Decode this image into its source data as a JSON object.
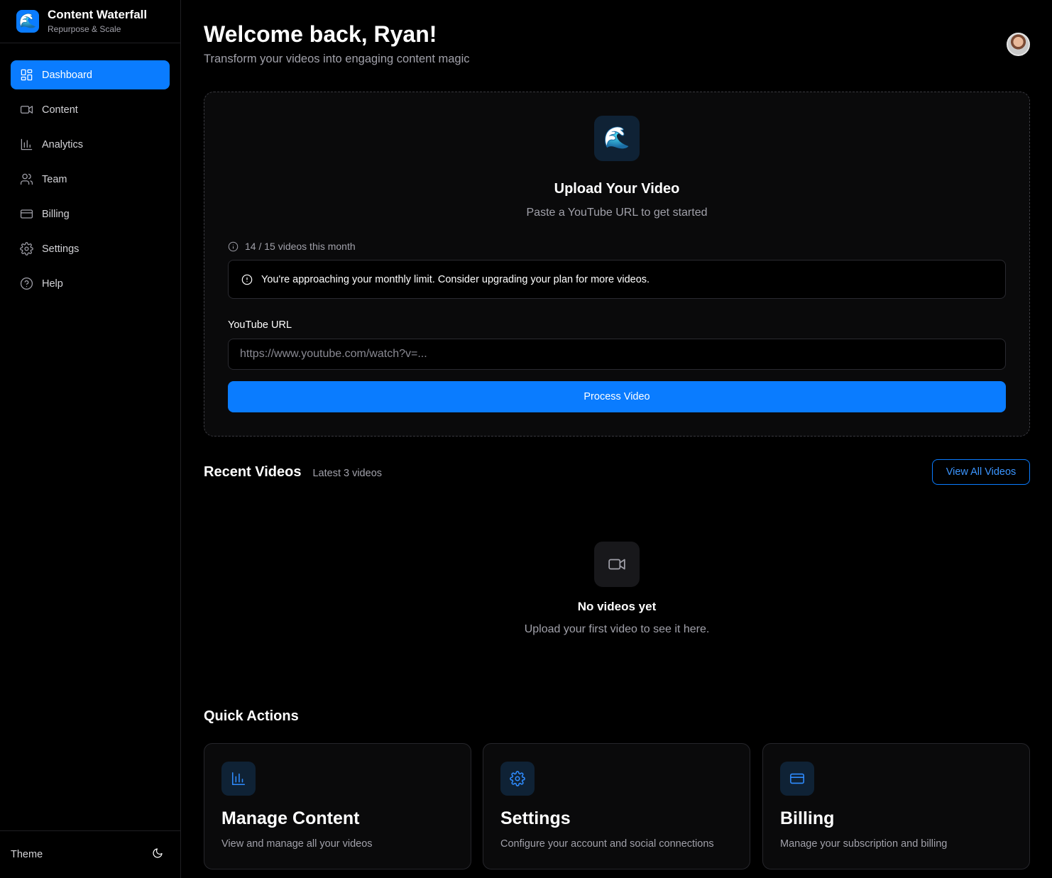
{
  "brand": {
    "logo": "🌊",
    "title": "Content Waterfall",
    "subtitle": "Repurpose & Scale"
  },
  "sidebar": {
    "items": [
      {
        "label": "Dashboard",
        "icon": "dashboard-icon",
        "active": true
      },
      {
        "label": "Content",
        "icon": "video-icon"
      },
      {
        "label": "Analytics",
        "icon": "bar-chart-icon"
      },
      {
        "label": "Team",
        "icon": "users-icon"
      },
      {
        "label": "Billing",
        "icon": "credit-card-icon"
      },
      {
        "label": "Settings",
        "icon": "gear-icon"
      },
      {
        "label": "Help",
        "icon": "help-circle-icon"
      }
    ],
    "footer": {
      "theme_label": "Theme",
      "theme_icon": "moon-icon"
    }
  },
  "header": {
    "welcome": "Welcome back, Ryan!",
    "subtitle": "Transform your videos into engaging content magic"
  },
  "upload": {
    "icon": "🌊",
    "title": "Upload Your Video",
    "subtitle": "Paste a YouTube URL to get started",
    "quota": "14 / 15 videos this month",
    "alert": "You're approaching your monthly limit. Consider upgrading your plan for more videos.",
    "url_label": "YouTube URL",
    "url_placeholder": "https://www.youtube.com/watch?v=...",
    "url_value": "",
    "button": "Process Video"
  },
  "recent": {
    "title": "Recent Videos",
    "subtitle": "Latest 3 videos",
    "view_all": "View All Videos",
    "empty_title": "No videos yet",
    "empty_subtitle": "Upload your first video to see it here."
  },
  "quick_actions": {
    "title": "Quick Actions",
    "items": [
      {
        "title": "Manage Content",
        "description": "View and manage all your videos",
        "icon": "bar-chart-icon"
      },
      {
        "title": "Settings",
        "description": "Configure your account and social connections",
        "icon": "gear-icon"
      },
      {
        "title": "Billing",
        "description": "Manage your subscription and billing",
        "icon": "credit-card-icon"
      }
    ]
  },
  "colors": {
    "accent": "#0a7cff",
    "background": "#000000",
    "muted_text": "#a1a1aa"
  }
}
